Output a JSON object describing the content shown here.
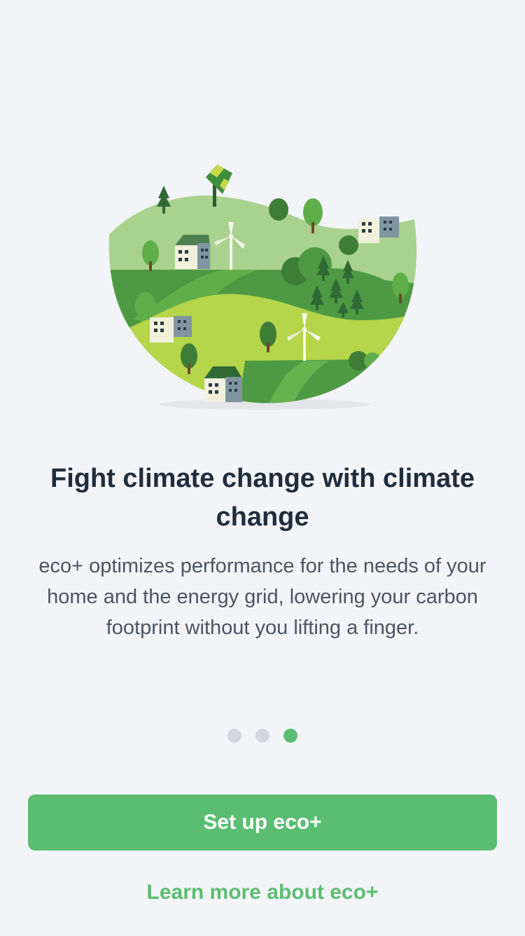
{
  "onboarding": {
    "illustration": "eco-landscape-illustration",
    "headline": "Fight climate change with climate change",
    "body": "eco+ optimizes performance for the needs of your home and the energy grid, lowering your carbon footprint without you lifting a finger.",
    "pager": {
      "total": 3,
      "current": 3
    }
  },
  "actions": {
    "primary_label": "Set up eco+",
    "secondary_label": "Learn more about eco+"
  },
  "colors": {
    "background": "#f3f4f8",
    "accent": "#5bbd72",
    "text_dark": "#1f2d3d",
    "text_body": "#4a5563",
    "dot_inactive": "#d4d6db"
  }
}
